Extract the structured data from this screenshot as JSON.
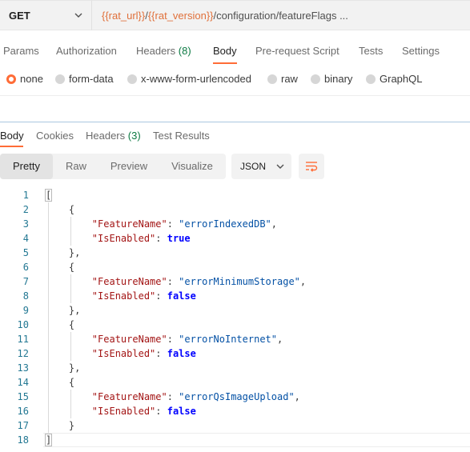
{
  "request": {
    "method": "GET",
    "url_parts": [
      {
        "text": "{{rat_url}}",
        "kind": "var"
      },
      {
        "text": "/",
        "kind": "plain"
      },
      {
        "text": "{{rat_version}}",
        "kind": "var"
      },
      {
        "text": "/configuration/featureFlags ...",
        "kind": "plain"
      }
    ]
  },
  "request_tabs": {
    "params": "Params",
    "authorization": "Authorization",
    "headers": "Headers",
    "headers_count": "(8)",
    "body": "Body",
    "pre_request": "Pre-request Script",
    "tests": "Tests",
    "settings": "Settings",
    "active": "Body"
  },
  "body_types": {
    "none": "none",
    "form_data": "form-data",
    "urlencoded": "x-www-form-urlencoded",
    "raw": "raw",
    "binary": "binary",
    "graphql": "GraphQL",
    "selected": "none"
  },
  "response_tabs": {
    "body": "Body",
    "cookies": "Cookies",
    "headers": "Headers",
    "headers_count": "(3)",
    "test_results": "Test Results",
    "active": "Body"
  },
  "view_modes": {
    "pretty": "Pretty",
    "raw": "Raw",
    "preview": "Preview",
    "visualize": "Visualize",
    "active": "Pretty"
  },
  "format": "JSON",
  "code_lines": [
    {
      "n": "1",
      "tokens": [
        {
          "t": "[",
          "c": "p"
        }
      ]
    },
    {
      "n": "2",
      "tokens": [
        {
          "t": "    {",
          "c": "p"
        }
      ]
    },
    {
      "n": "3",
      "tokens": [
        {
          "t": "        ",
          "c": "p"
        },
        {
          "t": "\"FeatureName\"",
          "c": "k"
        },
        {
          "t": ": ",
          "c": "p"
        },
        {
          "t": "\"errorIndexedDB\"",
          "c": "s"
        },
        {
          "t": ",",
          "c": "p"
        }
      ]
    },
    {
      "n": "4",
      "tokens": [
        {
          "t": "        ",
          "c": "p"
        },
        {
          "t": "\"IsEnabled\"",
          "c": "k"
        },
        {
          "t": ": ",
          "c": "p"
        },
        {
          "t": "true",
          "c": "b"
        }
      ]
    },
    {
      "n": "5",
      "tokens": [
        {
          "t": "    },",
          "c": "p"
        }
      ]
    },
    {
      "n": "6",
      "tokens": [
        {
          "t": "    {",
          "c": "p"
        }
      ]
    },
    {
      "n": "7",
      "tokens": [
        {
          "t": "        ",
          "c": "p"
        },
        {
          "t": "\"FeatureName\"",
          "c": "k"
        },
        {
          "t": ": ",
          "c": "p"
        },
        {
          "t": "\"errorMinimumStorage\"",
          "c": "s"
        },
        {
          "t": ",",
          "c": "p"
        }
      ]
    },
    {
      "n": "8",
      "tokens": [
        {
          "t": "        ",
          "c": "p"
        },
        {
          "t": "\"IsEnabled\"",
          "c": "k"
        },
        {
          "t": ": ",
          "c": "p"
        },
        {
          "t": "false",
          "c": "b"
        }
      ]
    },
    {
      "n": "9",
      "tokens": [
        {
          "t": "    },",
          "c": "p"
        }
      ]
    },
    {
      "n": "10",
      "tokens": [
        {
          "t": "    {",
          "c": "p"
        }
      ]
    },
    {
      "n": "11",
      "tokens": [
        {
          "t": "        ",
          "c": "p"
        },
        {
          "t": "\"FeatureName\"",
          "c": "k"
        },
        {
          "t": ": ",
          "c": "p"
        },
        {
          "t": "\"errorNoInternet\"",
          "c": "s"
        },
        {
          "t": ",",
          "c": "p"
        }
      ]
    },
    {
      "n": "12",
      "tokens": [
        {
          "t": "        ",
          "c": "p"
        },
        {
          "t": "\"IsEnabled\"",
          "c": "k"
        },
        {
          "t": ": ",
          "c": "p"
        },
        {
          "t": "false",
          "c": "b"
        }
      ]
    },
    {
      "n": "13",
      "tokens": [
        {
          "t": "    },",
          "c": "p"
        }
      ]
    },
    {
      "n": "14",
      "tokens": [
        {
          "t": "    {",
          "c": "p"
        }
      ]
    },
    {
      "n": "15",
      "tokens": [
        {
          "t": "        ",
          "c": "p"
        },
        {
          "t": "\"FeatureName\"",
          "c": "k"
        },
        {
          "t": ": ",
          "c": "p"
        },
        {
          "t": "\"errorQsImageUpload\"",
          "c": "s"
        },
        {
          "t": ",",
          "c": "p"
        }
      ]
    },
    {
      "n": "16",
      "tokens": [
        {
          "t": "        ",
          "c": "p"
        },
        {
          "t": "\"IsEnabled\"",
          "c": "k"
        },
        {
          "t": ": ",
          "c": "p"
        },
        {
          "t": "false",
          "c": "b"
        }
      ]
    },
    {
      "n": "17",
      "tokens": [
        {
          "t": "    }",
          "c": "p"
        }
      ]
    },
    {
      "n": "18",
      "tokens": [
        {
          "t": "]",
          "c": "p"
        }
      ]
    }
  ],
  "colors": {
    "accent": "#ff6c37",
    "count_green": "#0c7a43",
    "json_key": "#a31515",
    "json_string": "#0451a5",
    "json_bool": "#0000ff",
    "line_number": "#237893",
    "url_variable": "#e0703a"
  },
  "icons": {
    "method_dropdown": "chevron-down-icon",
    "format_dropdown": "chevron-down-icon",
    "wrap": "wrap-lines-icon",
    "radio": "radio-icon"
  }
}
